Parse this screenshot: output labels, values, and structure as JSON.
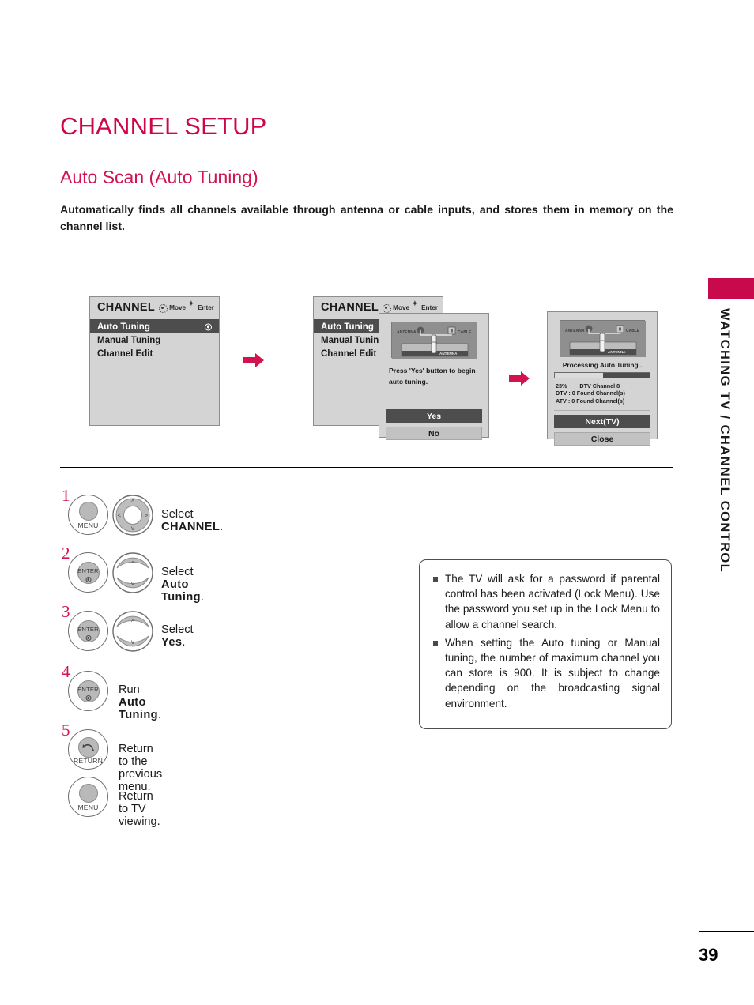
{
  "page": {
    "title": "CHANNEL SETUP",
    "section_title": "Auto Scan (Auto Tuning)",
    "intro": "Automatically finds all channels available through antenna or cable inputs, and stores them in memory on the channel list.",
    "number": "39",
    "sidebar_text": "WATCHING TV / CHANNEL CONTROL"
  },
  "osd": {
    "menu_title": "CHANNEL",
    "hint_move": "Move",
    "hint_enter": "Enter",
    "items": [
      {
        "label": "Auto Tuning",
        "selected": true
      },
      {
        "label": "Manual Tuning",
        "selected": false
      },
      {
        "label": "Channel Edit",
        "selected": false
      }
    ],
    "illustration": {
      "antenna_label": "ANTENNA",
      "cable_label": "CABLE",
      "port_label": "ANTENNA"
    },
    "confirm_dialog": {
      "message": "Press 'Yes' button to begin auto tuning.",
      "yes_label": "Yes",
      "no_label": "No"
    },
    "progress_dialog": {
      "status": "Processing Auto Tuning..",
      "percent": "23%",
      "percent_value": 23,
      "current_channel": "DTV Channel 8",
      "dtv_found": "DTV : 0 Found Channel(s)",
      "atv_found": "ATV : 0 Found Channel(s)",
      "next_label": "Next(TV)",
      "close_label": "Close"
    }
  },
  "steps": [
    {
      "num": "1",
      "button_label": "MENU",
      "has_dpad": true,
      "dpad_type": "four-way",
      "text_prefix": "Select ",
      "text_bold": "CHANNEL",
      "text_suffix": "."
    },
    {
      "num": "2",
      "button_label": "ENTER",
      "has_dpad": true,
      "dpad_type": "updown",
      "text_prefix": "Select ",
      "text_bold": "Auto Tuning",
      "text_suffix": "."
    },
    {
      "num": "3",
      "button_label": "ENTER",
      "has_dpad": true,
      "dpad_type": "updown",
      "text_prefix": "Select ",
      "text_bold": "Yes",
      "text_suffix": "."
    },
    {
      "num": "4",
      "button_label": "ENTER",
      "has_dpad": false,
      "text_prefix": "Run ",
      "text_bold": "Auto Tuning",
      "text_suffix": "."
    },
    {
      "num": "5",
      "button_label": "RETURN",
      "has_dpad": false,
      "text_prefix": "Return to the previous menu.",
      "text_bold": "",
      "text_suffix": ""
    },
    {
      "num": "",
      "button_label": "MENU",
      "has_dpad": false,
      "text_prefix": "Return to TV viewing.",
      "text_bold": "",
      "text_suffix": ""
    }
  ],
  "notes": [
    "The TV will ask for a password if parental control has been activated (Lock Menu). Use the password you set up in the Lock Menu to allow a channel search.",
    "When setting the Auto tuning or Manual tuning, the number of maximum channel you can store is 900. It is subject to change depending on the broadcasting signal environment."
  ],
  "colors": {
    "brand_crimson": "#cc0747",
    "heading_pink": "#d2134f",
    "osd_gray": "#d4d4d4",
    "osd_selected": "#4d4d4d",
    "arrow_pink": "#d2134f"
  }
}
